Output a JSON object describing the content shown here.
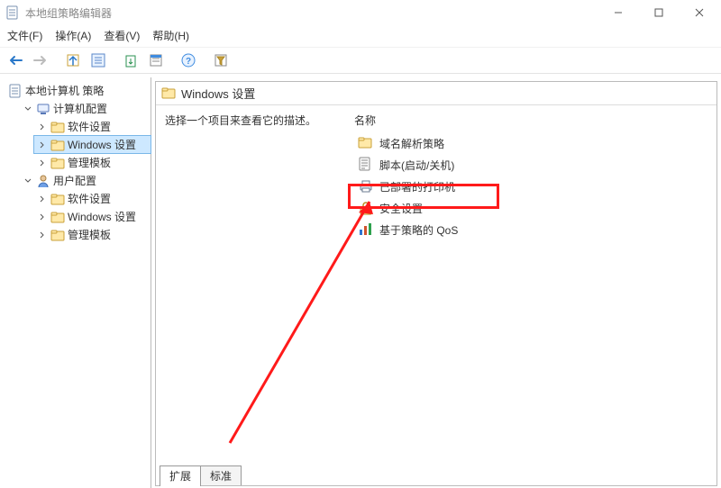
{
  "titlebar": {
    "title": "本地组策略编辑器"
  },
  "menu": {
    "file": "文件(F)",
    "action": "操作(A)",
    "view": "查看(V)",
    "help": "帮助(H)"
  },
  "tree": {
    "root": "本地计算机 策略",
    "computer": "计算机配置",
    "comp_software": "软件设置",
    "comp_windows": "Windows 设置",
    "comp_templates": "管理模板",
    "user": "用户配置",
    "user_software": "软件设置",
    "user_windows": "Windows 设置",
    "user_templates": "管理模板"
  },
  "panel": {
    "heading": "Windows 设置",
    "prompt": "选择一个项目来查看它的描述。",
    "column_name": "名称"
  },
  "items": {
    "dns": "域名解析策略",
    "scripts": "脚本(启动/关机)",
    "printers": "已部署的打印机",
    "security": "安全设置",
    "qos": "基于策略的 QoS"
  },
  "tabs": {
    "extended": "扩展",
    "standard": "标准"
  }
}
